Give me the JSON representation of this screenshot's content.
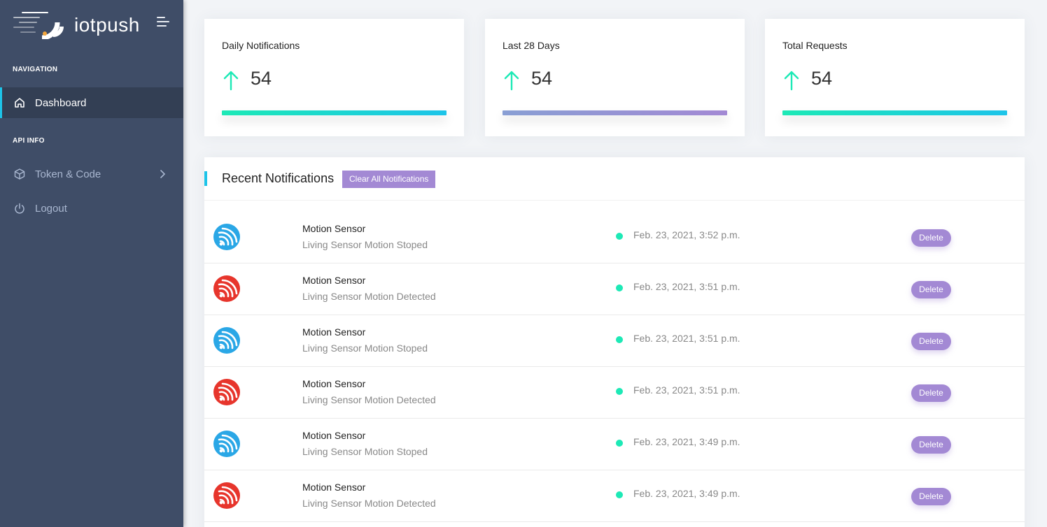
{
  "brand": {
    "name": "iotpush"
  },
  "nav": {
    "caption_navigation": "NAVIGATION",
    "dashboard": "Dashboard",
    "caption_api": "API INFO",
    "token_code": "Token & Code",
    "logout": "Logout"
  },
  "stats": [
    {
      "title": "Daily Notifications",
      "value": "54",
      "bar_color": "teal"
    },
    {
      "title": "Last 28 Days",
      "value": "54",
      "bar_color": "purple"
    },
    {
      "title": "Total Requests",
      "value": "54",
      "bar_color": "teal"
    }
  ],
  "notifications": {
    "title": "Recent Notifications",
    "clear_label": "Clear All Notifications",
    "delete_label": "Delete",
    "rows": [
      {
        "title": "Motion Sensor",
        "desc": "Living Sensor Motion Stoped",
        "time": "Feb. 23, 2021, 3:52 p.m.",
        "icon_color": "blue"
      },
      {
        "title": "Motion Sensor",
        "desc": "Living Sensor Motion Detected",
        "time": "Feb. 23, 2021, 3:51 p.m.",
        "icon_color": "red"
      },
      {
        "title": "Motion Sensor",
        "desc": "Living Sensor Motion Stoped",
        "time": "Feb. 23, 2021, 3:51 p.m.",
        "icon_color": "blue"
      },
      {
        "title": "Motion Sensor",
        "desc": "Living Sensor Motion Detected",
        "time": "Feb. 23, 2021, 3:51 p.m.",
        "icon_color": "red"
      },
      {
        "title": "Motion Sensor",
        "desc": "Living Sensor Motion Stoped",
        "time": "Feb. 23, 2021, 3:49 p.m.",
        "icon_color": "blue"
      },
      {
        "title": "Motion Sensor",
        "desc": "Living Sensor Motion Detected",
        "time": "Feb. 23, 2021, 3:49 p.m.",
        "icon_color": "red"
      }
    ]
  },
  "colors": {
    "sidebar": "#3f4d67",
    "accent_teal": "#1de9b6",
    "accent_blue": "#1dc4e9",
    "accent_purple": "#a389d4",
    "esp_blue": "#2aa7e6",
    "esp_red": "#e7352c"
  }
}
